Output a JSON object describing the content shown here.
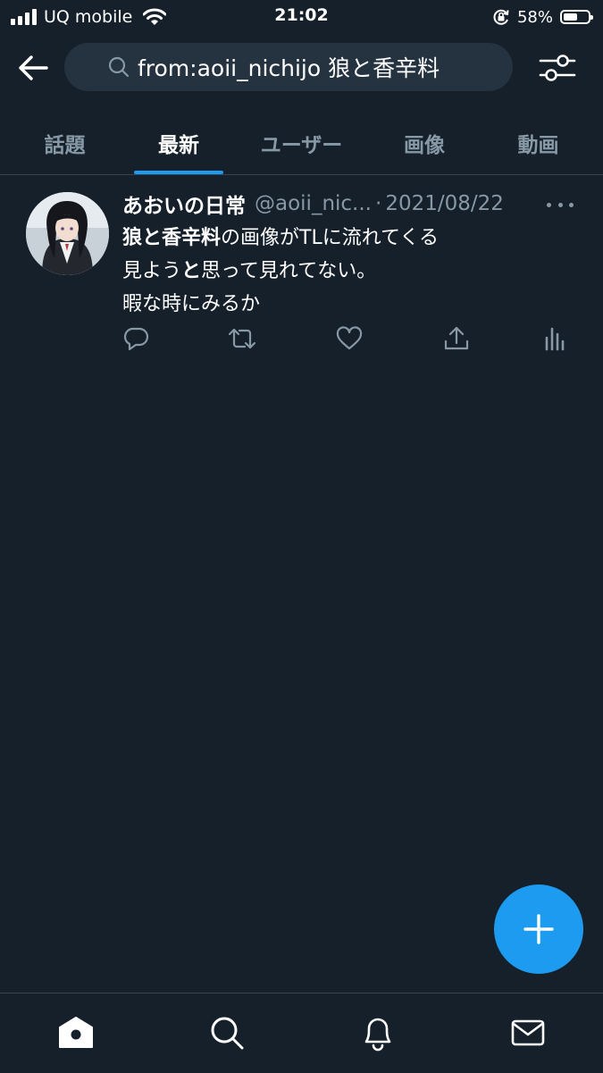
{
  "status_bar": {
    "carrier": "UQ mobile",
    "time": "21:02",
    "battery_percent": "58%",
    "battery_level": 0.58,
    "signal_bars": 4
  },
  "search": {
    "query": "from:aoii_nichijo 狼と香辛料",
    "icons": {
      "back": "arrow-left-icon",
      "search": "search-icon",
      "filter": "filter-sliders-icon"
    }
  },
  "tabs": [
    {
      "label": "話題",
      "active": false
    },
    {
      "label": "最新",
      "active": true
    },
    {
      "label": "ユーザー",
      "active": false
    },
    {
      "label": "画像",
      "active": false
    },
    {
      "label": "動画",
      "active": false
    }
  ],
  "tweet": {
    "display_name": "あおいの日常",
    "handle": "@aoii_nic...",
    "separator": "·",
    "date": "2021/08/22",
    "lines": [
      [
        {
          "text": "狼と香辛料",
          "bold": true
        },
        {
          "text": "の画像がTLに流れてくる",
          "bold": false
        }
      ],
      [
        {
          "text": "見よう",
          "bold": false
        },
        {
          "text": "と",
          "bold": true
        },
        {
          "text": "思って見れてない。",
          "bold": false
        }
      ],
      [
        {
          "text": "暇な時にみるか",
          "bold": false
        }
      ]
    ],
    "action_icons": [
      "reply-icon",
      "retweet-icon",
      "like-icon",
      "share-icon",
      "analytics-icon"
    ]
  },
  "fab": {
    "icon": "plus-icon"
  },
  "bottom_nav": [
    "home-icon",
    "search-icon",
    "notifications-icon",
    "messages-icon"
  ],
  "colors": {
    "background": "#15202b",
    "accent": "#1d9bf0",
    "secondary_text": "#8899a6",
    "search_field": "#253341",
    "divider": "#38444d"
  }
}
